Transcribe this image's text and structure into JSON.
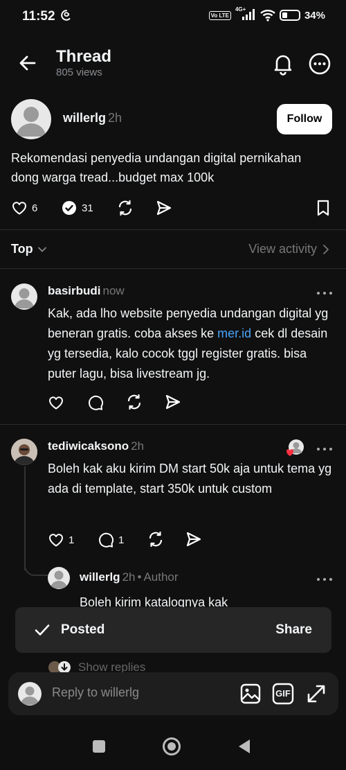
{
  "status": {
    "time": "11:52",
    "network": "4G+",
    "volte": "Vo LTE",
    "battery": "34%",
    "battery_level": 0.34
  },
  "header": {
    "title": "Thread",
    "views": "805 views"
  },
  "post": {
    "username": "willerlg",
    "time": "2h",
    "follow_label": "Follow",
    "text": "Rekomendasi penyedia undangan digital pernikahan dong warga tread...budget max 100k",
    "likes": "6",
    "replies": "31"
  },
  "sort": {
    "label": "Top",
    "view_activity": "View activity"
  },
  "replies": [
    {
      "username": "basirbudi",
      "time": "now",
      "text_before": "Kak, ada lho website penyedia undangan digital yg beneran gratis. coba akses ke ",
      "link": "mer.id",
      "text_after": " cek dl desain yg tersedia, kalo cocok tggl register gratis. bisa puter lagu, bisa livestream jg."
    },
    {
      "username": "tediwicaksono",
      "time": "2h",
      "text": "Boleh kak aku kirim DM start 50k aja untuk tema yg ada di template, start 350k untuk custom",
      "likes": "1",
      "replies": "1"
    },
    {
      "username": "willerlg",
      "time": "2h",
      "author_label": "Author",
      "text": "Boleh kirim katalognya kak"
    }
  ],
  "toast": {
    "label": "Posted",
    "action": "Share"
  },
  "show_replies": "Show replies",
  "reply_bar": {
    "placeholder": "Reply to willerlg",
    "gif_label": "GIF"
  }
}
